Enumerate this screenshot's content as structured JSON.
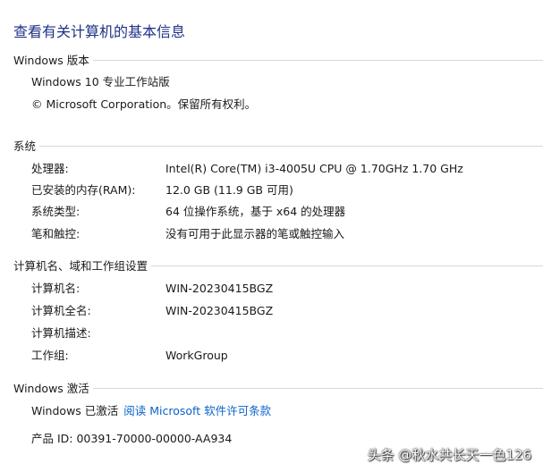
{
  "page_title": "查看有关计算机的基本信息",
  "edition_section": {
    "header": "Windows 版本",
    "edition": "Windows 10 专业工作站版",
    "copyright": "© Microsoft Corporation。保留所有权利。"
  },
  "system_section": {
    "header": "系统",
    "rows": [
      {
        "label": "处理器:",
        "value": "Intel(R) Core(TM) i3-4005U CPU @ 1.70GHz   1.70 GHz"
      },
      {
        "label": "已安装的内存(RAM):",
        "value": "12.0 GB (11.9 GB 可用)"
      },
      {
        "label": "系统类型:",
        "value": "64 位操作系统，基于 x64 的处理器"
      },
      {
        "label": "笔和触控:",
        "value": "没有可用于此显示器的笔或触控输入"
      }
    ]
  },
  "computer_section": {
    "header": "计算机名、域和工作组设置",
    "rows": [
      {
        "label": "计算机名:",
        "value": "WIN-20230415BGZ"
      },
      {
        "label": "计算机全名:",
        "value": "WIN-20230415BGZ"
      },
      {
        "label": "计算机描述:",
        "value": ""
      },
      {
        "label": "工作组:",
        "value": "WorkGroup"
      }
    ]
  },
  "activation_section": {
    "header": "Windows 激活",
    "status": "Windows 已激活",
    "license_link": "阅读 Microsoft 软件许可条款",
    "product_id": "产品 ID: 00391-70000-00000-AA934"
  },
  "watermark": "头条 @秋水共长天一色126",
  "colors": {
    "title": "#1e3287",
    "link": "#0b63c9",
    "rule": "#d8d8d8"
  }
}
